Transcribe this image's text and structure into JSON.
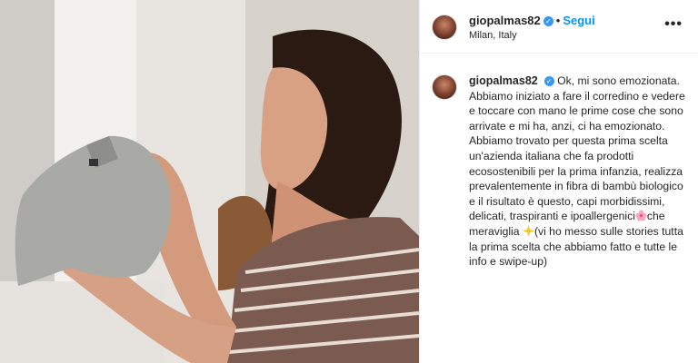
{
  "post": {
    "username": "giopalmas82",
    "location": "Milan, Italy",
    "follow_label": "Segui",
    "separator": "•",
    "more_label": "•••",
    "verified_mark": "✓"
  },
  "caption": {
    "part1": "Ok, mi sono emozionata. Abbiamo iniziato a fare il corredino e vedere e toccare con mano le prime cose che sono arrivate e mi ha, anzi, ci ha emozionato.",
    "part2": "Abbiamo trovato per questa prima scelta un'azienda italiana che fa prodotti ecosostenibili per la prima infanzia, realizza prevalentemente in fibra di bambù biologico e il risultato è questo, capi morbidissimi, delicati, traspiranti e ipoallergenici",
    "part3": "che meraviglia",
    "part4": "(vi ho messo sulle stories tutta la prima scelta che abbiamo fatto e tutte le info e swipe-up)"
  },
  "icons": {
    "verified": "verified-badge-icon",
    "flower_emoji": "cherry-blossom-emoji",
    "sparkle_emoji": "sparkle-star-emoji",
    "more": "more-options-icon"
  },
  "colors": {
    "accent": "#0095f6",
    "verified": "#3897f0",
    "text": "#262626",
    "border": "#efefef"
  }
}
